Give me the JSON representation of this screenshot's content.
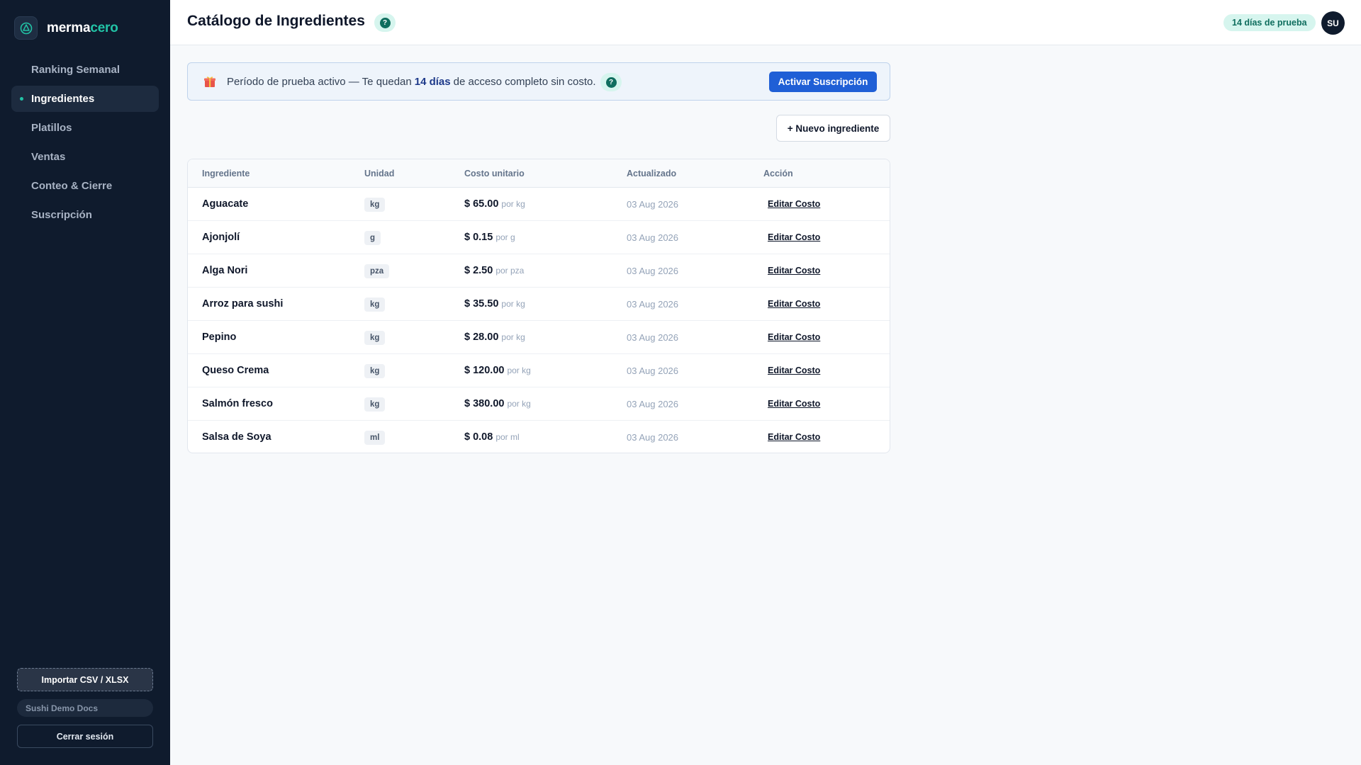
{
  "brand": {
    "name_part1": "merma",
    "name_part2": "cero"
  },
  "sidebar": {
    "items": [
      {
        "label": "Ranking Semanal",
        "active": false
      },
      {
        "label": "Ingredientes",
        "active": true
      },
      {
        "label": "Platillos",
        "active": false
      },
      {
        "label": "Ventas",
        "active": false
      },
      {
        "label": "Conteo & Cierre",
        "active": false
      },
      {
        "label": "Suscripción",
        "active": false
      }
    ],
    "import_label": "Importar CSV / XLSX",
    "workspace": "Sushi Demo Docs",
    "logout_label": "Cerrar sesión"
  },
  "header": {
    "title": "Catálogo de Ingredientes",
    "help": "?",
    "trial_badge": "14 días de prueba",
    "avatar": "SU"
  },
  "banner": {
    "text_before": "Período de prueba activo — Te quedan",
    "days": "14 días",
    "text_after": "de acceso completo sin costo.",
    "help": "?",
    "cta": "Activar Suscripción"
  },
  "new_button": "+ Nuevo ingrediente",
  "table": {
    "headers": [
      "Ingrediente",
      "Unidad",
      "Costo unitario",
      "Actualizado",
      "Acción"
    ],
    "rows": [
      {
        "name": "Aguacate",
        "unit": "kg",
        "cost": "$ 65.00",
        "per": "por kg",
        "updated": "03 Aug 2026",
        "action": "Editar Costo"
      },
      {
        "name": "Ajonjolí",
        "unit": "g",
        "cost": "$ 0.15",
        "per": "por g",
        "updated": "03 Aug 2026",
        "action": "Editar Costo"
      },
      {
        "name": "Alga Nori",
        "unit": "pza",
        "cost": "$ 2.50",
        "per": "por pza",
        "updated": "03 Aug 2026",
        "action": "Editar Costo"
      },
      {
        "name": "Arroz para sushi",
        "unit": "kg",
        "cost": "$ 35.50",
        "per": "por kg",
        "updated": "03 Aug 2026",
        "action": "Editar Costo"
      },
      {
        "name": "Pepino",
        "unit": "kg",
        "cost": "$ 28.00",
        "per": "por kg",
        "updated": "03 Aug 2026",
        "action": "Editar Costo"
      },
      {
        "name": "Queso Crema",
        "unit": "kg",
        "cost": "$ 120.00",
        "per": "por kg",
        "updated": "03 Aug 2026",
        "action": "Editar Costo"
      },
      {
        "name": "Salmón fresco",
        "unit": "kg",
        "cost": "$ 380.00",
        "per": "por kg",
        "updated": "03 Aug 2026",
        "action": "Editar Costo"
      },
      {
        "name": "Salsa de Soya",
        "unit": "ml",
        "cost": "$ 0.08",
        "per": "por ml",
        "updated": "03 Aug 2026",
        "action": "Editar Costo"
      }
    ]
  },
  "colors": {
    "sidebar_bg": "#0f1b2d",
    "accent": "#22c3a6",
    "primary_button": "#1f5fd6"
  }
}
